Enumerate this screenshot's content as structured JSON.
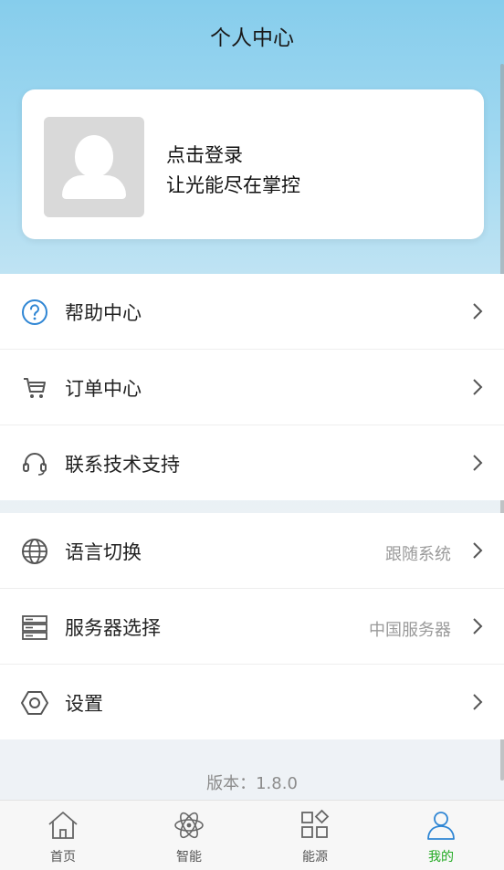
{
  "header": {
    "title": "个人中心"
  },
  "profile": {
    "login_label": "点击登录",
    "slogan": "让光能尽在掌控",
    "avatar_icon": "user-placeholder-icon"
  },
  "menu_group_1": [
    {
      "icon": "help-circle-icon",
      "label": "帮助中心",
      "value": ""
    },
    {
      "icon": "cart-icon",
      "label": "订单中心",
      "value": ""
    },
    {
      "icon": "headset-icon",
      "label": "联系技术支持",
      "value": ""
    }
  ],
  "menu_group_2": [
    {
      "icon": "globe-icon",
      "label": "语言切换",
      "value": "跟随系统"
    },
    {
      "icon": "server-icon",
      "label": "服务器选择",
      "value": "中国服务器"
    },
    {
      "icon": "hexagon-settings-icon",
      "label": "设置",
      "value": ""
    }
  ],
  "version": "版本：1.8.0",
  "tabs": [
    {
      "icon": "home-icon",
      "label": "首页",
      "active": false
    },
    {
      "icon": "atom-icon",
      "label": "智能",
      "active": false
    },
    {
      "icon": "grid-diamond-icon",
      "label": "能源",
      "active": false
    },
    {
      "icon": "user-icon",
      "label": "我的",
      "active": true
    }
  ],
  "colors": {
    "accent": "#22aa22",
    "icon_blue": "#2f86d4",
    "header_bg": "#8dcfec"
  }
}
